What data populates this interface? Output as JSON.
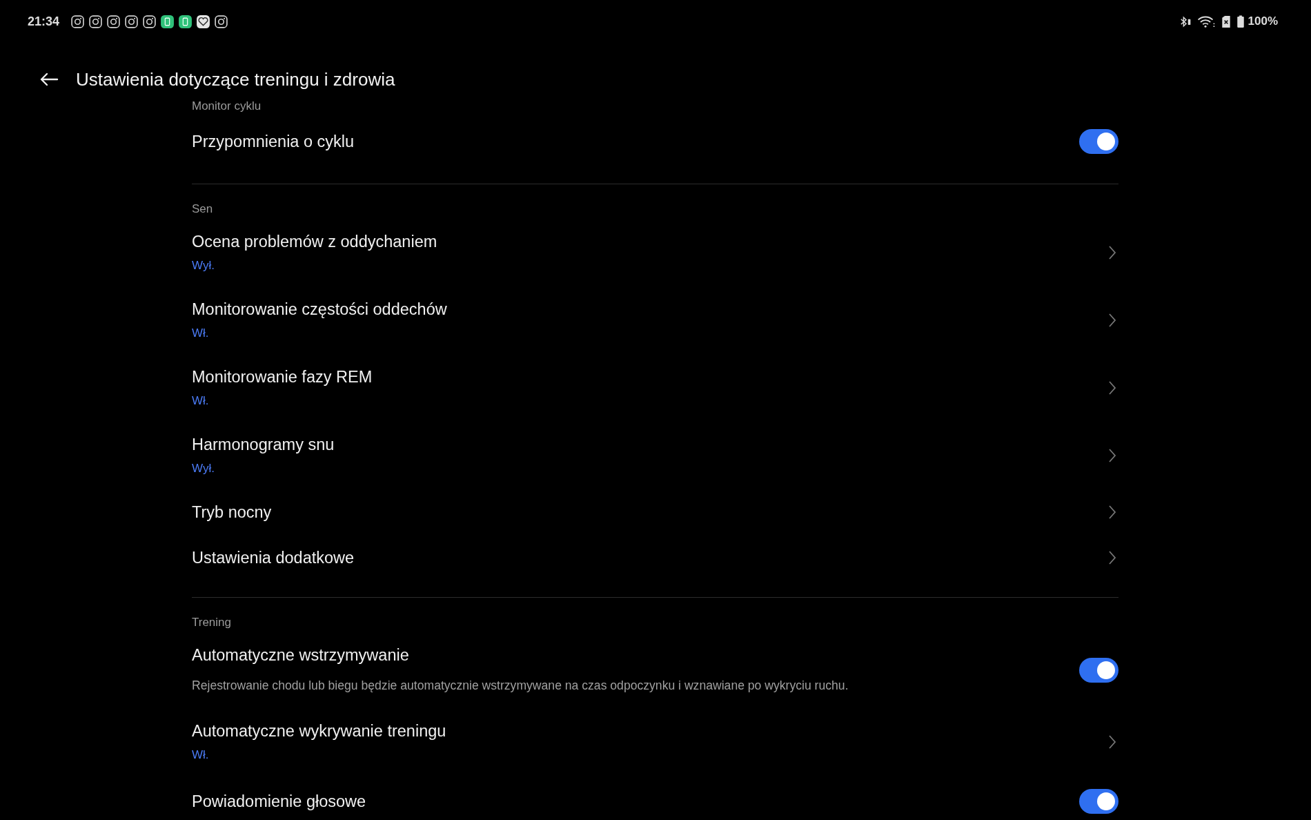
{
  "status_bar": {
    "time": "21:34",
    "battery": "100%"
  },
  "header": {
    "title": "Ustawienia dotyczące treningu i zdrowia"
  },
  "sections": [
    {
      "label": "Monitor cyklu",
      "items": [
        {
          "kind": "toggle",
          "title": "Przypomnienia o cyklu",
          "on": true
        }
      ]
    },
    {
      "label": "Sen",
      "items": [
        {
          "kind": "link",
          "title": "Ocena problemów z oddychaniem",
          "value": "Wył."
        },
        {
          "kind": "link",
          "title": "Monitorowanie częstości oddechów",
          "value": "Wł."
        },
        {
          "kind": "link",
          "title": "Monitorowanie fazy REM",
          "value": "Wł."
        },
        {
          "kind": "link",
          "title": "Harmonogramy snu",
          "value": "Wył."
        },
        {
          "kind": "link",
          "title": "Tryb nocny"
        },
        {
          "kind": "link",
          "title": "Ustawienia dodatkowe"
        }
      ]
    },
    {
      "label": "Trening",
      "items": [
        {
          "kind": "toggle",
          "title": "Automatyczne wstrzymywanie",
          "on": true,
          "description": "Rejestrowanie chodu lub biegu będzie automatycznie wstrzymywane na czas odpoczynku i wznawiane po wykryciu ruchu."
        },
        {
          "kind": "link",
          "title": "Automatyczne wykrywanie treningu",
          "value": "Wł."
        },
        {
          "kind": "toggle",
          "title": "Powiadomienie głosowe",
          "on": true
        }
      ]
    }
  ]
}
